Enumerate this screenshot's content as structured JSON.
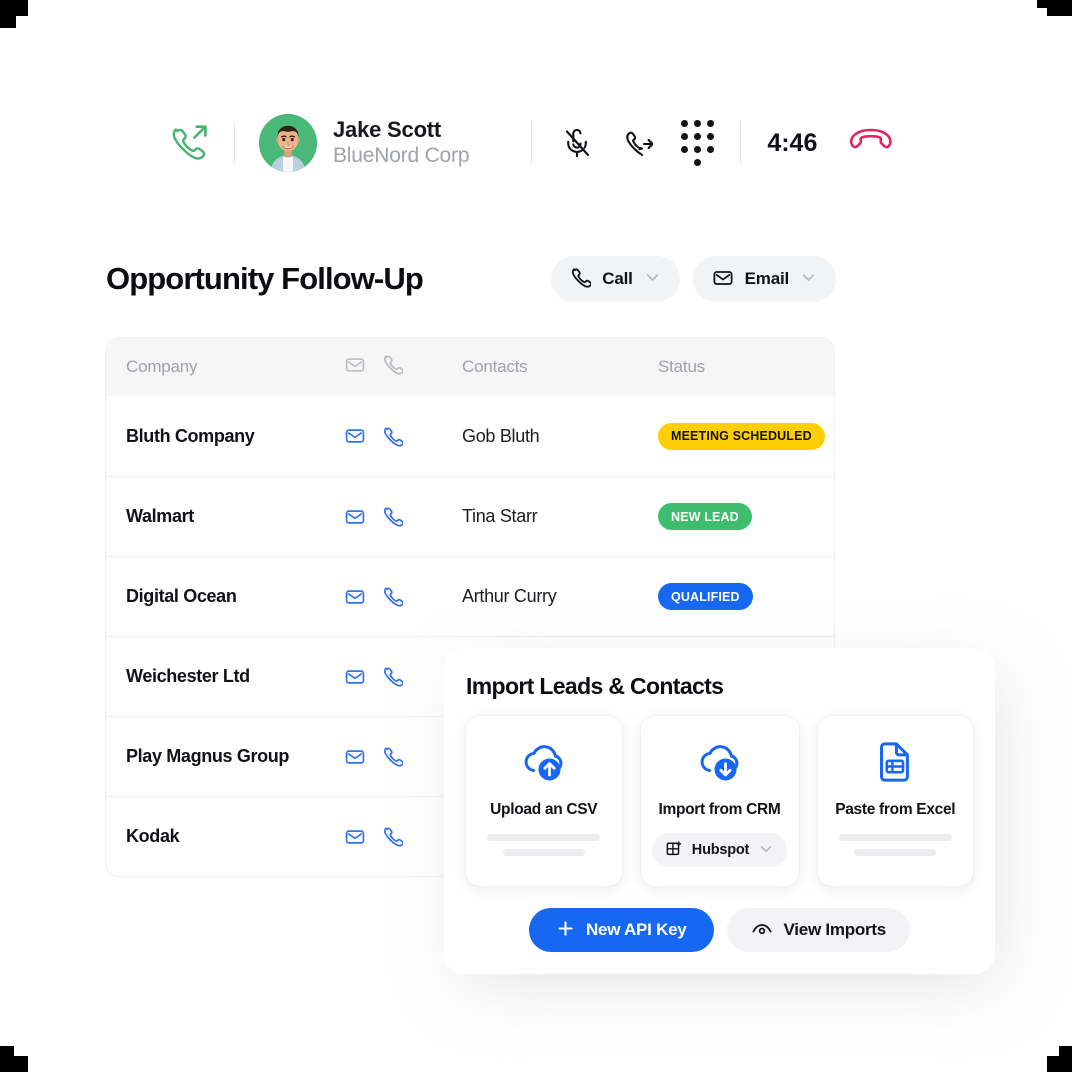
{
  "call_bar": {
    "outbound_icon": "outbound-call-icon",
    "caller_name": "Jake Scott",
    "caller_org": "BlueNord Corp",
    "timer": "4:46",
    "controls": [
      {
        "icon": "microphone-muted-icon",
        "name": "mute-button"
      },
      {
        "icon": "call-transfer-icon",
        "name": "transfer-button"
      },
      {
        "icon": "dialpad-icon",
        "name": "dialpad-button"
      }
    ],
    "hangup_icon": "hangup-icon",
    "colors": {
      "outbound": "#43b56e",
      "hangup": "#e3245f"
    }
  },
  "header": {
    "title": "Opportunity Follow-Up",
    "actions": [
      {
        "label": "Call",
        "icon": "phone-icon"
      },
      {
        "label": "Email",
        "icon": "mail-icon"
      }
    ]
  },
  "table": {
    "columns": [
      {
        "label": "Company",
        "key": "company"
      },
      {
        "label": "",
        "key": "mail",
        "icon": "mail-icon"
      },
      {
        "label": "",
        "key": "phone",
        "icon": "phone-icon"
      },
      {
        "label": "Contacts",
        "key": "contact"
      },
      {
        "label": "Status",
        "key": "status"
      }
    ],
    "rows": [
      {
        "company": "Bluth Company",
        "contact": "Gob Bluth",
        "status": "MEETING SCHEDULED",
        "status_bg": "#ffce00",
        "status_fg": "#111216"
      },
      {
        "company": "Walmart",
        "contact": "Tina Starr",
        "status": "NEW LEAD",
        "status_bg": "#3fbd6f",
        "status_fg": "#ffffff"
      },
      {
        "company": "Digital Ocean",
        "contact": "Arthur Curry",
        "status": "QUALIFIED",
        "status_bg": "#1667f2",
        "status_fg": "#ffffff"
      },
      {
        "company": "Weichester Ltd",
        "contact": "",
        "status": "",
        "status_bg": "",
        "status_fg": ""
      },
      {
        "company": "Play Magnus Group",
        "contact": "",
        "status": "",
        "status_bg": "",
        "status_fg": ""
      },
      {
        "company": "Kodak",
        "contact": "",
        "status": "",
        "status_bg": "",
        "status_fg": ""
      }
    ],
    "row_icon_color": "#2f71ea"
  },
  "modal": {
    "title": "Import Leads & Contacts",
    "cards": [
      {
        "label": "Upload an CSV",
        "icon": "cloud-upload-icon"
      },
      {
        "label": "Import from CRM",
        "icon": "cloud-download-icon",
        "select": {
          "label": "Hubspot",
          "icon": "grid-plus-icon"
        }
      },
      {
        "label": "Paste from Excel",
        "icon": "spreadsheet-document-icon"
      }
    ],
    "actions": {
      "primary": {
        "label": "New API Key",
        "icon": "plus-icon"
      },
      "secondary": {
        "label": "View Imports",
        "icon": "eye-icon"
      }
    },
    "accent": "#1667f2"
  }
}
